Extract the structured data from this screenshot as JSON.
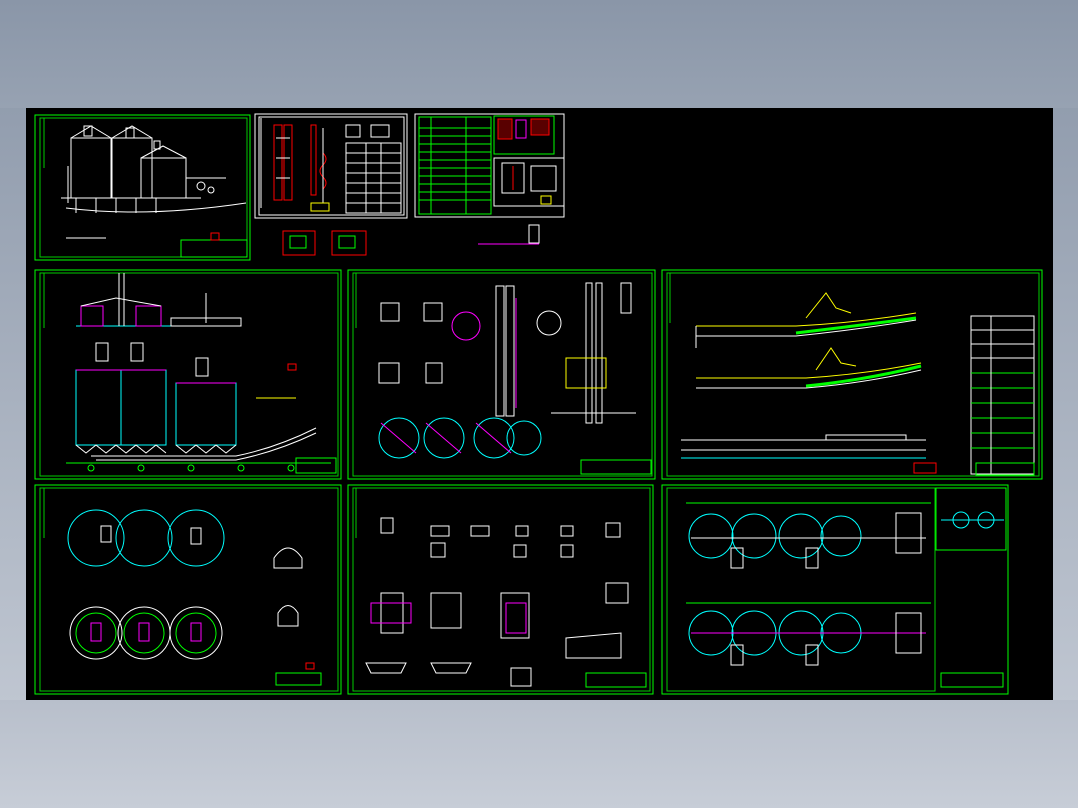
{
  "viewer": {
    "background_gradient": [
      "#8a96a8",
      "#c7cdd7"
    ],
    "canvas_color": "#000000"
  },
  "colors": {
    "frame": "#00ff00",
    "frame_inner": "#00cc00",
    "cyan": "#00ffff",
    "magenta": "#ff00ff",
    "yellow": "#ffff00",
    "red": "#ff0000",
    "white": "#ffffff",
    "green": "#00ff00"
  },
  "sheets": [
    {
      "id": "sheet-process-flow",
      "kind": "elevation"
    },
    {
      "id": "sheet-bucket-elevator",
      "kind": "detail"
    },
    {
      "id": "sheet-equipment-list",
      "kind": "table"
    },
    {
      "id": "sheet-silo-elevation",
      "kind": "elevation"
    },
    {
      "id": "sheet-section-details",
      "kind": "section"
    },
    {
      "id": "sheet-conveyor-profile",
      "kind": "profile"
    },
    {
      "id": "sheet-silo-plan",
      "kind": "plan"
    },
    {
      "id": "sheet-embedded-parts",
      "kind": "detail"
    },
    {
      "id": "sheet-layout-plan",
      "kind": "plan"
    }
  ]
}
